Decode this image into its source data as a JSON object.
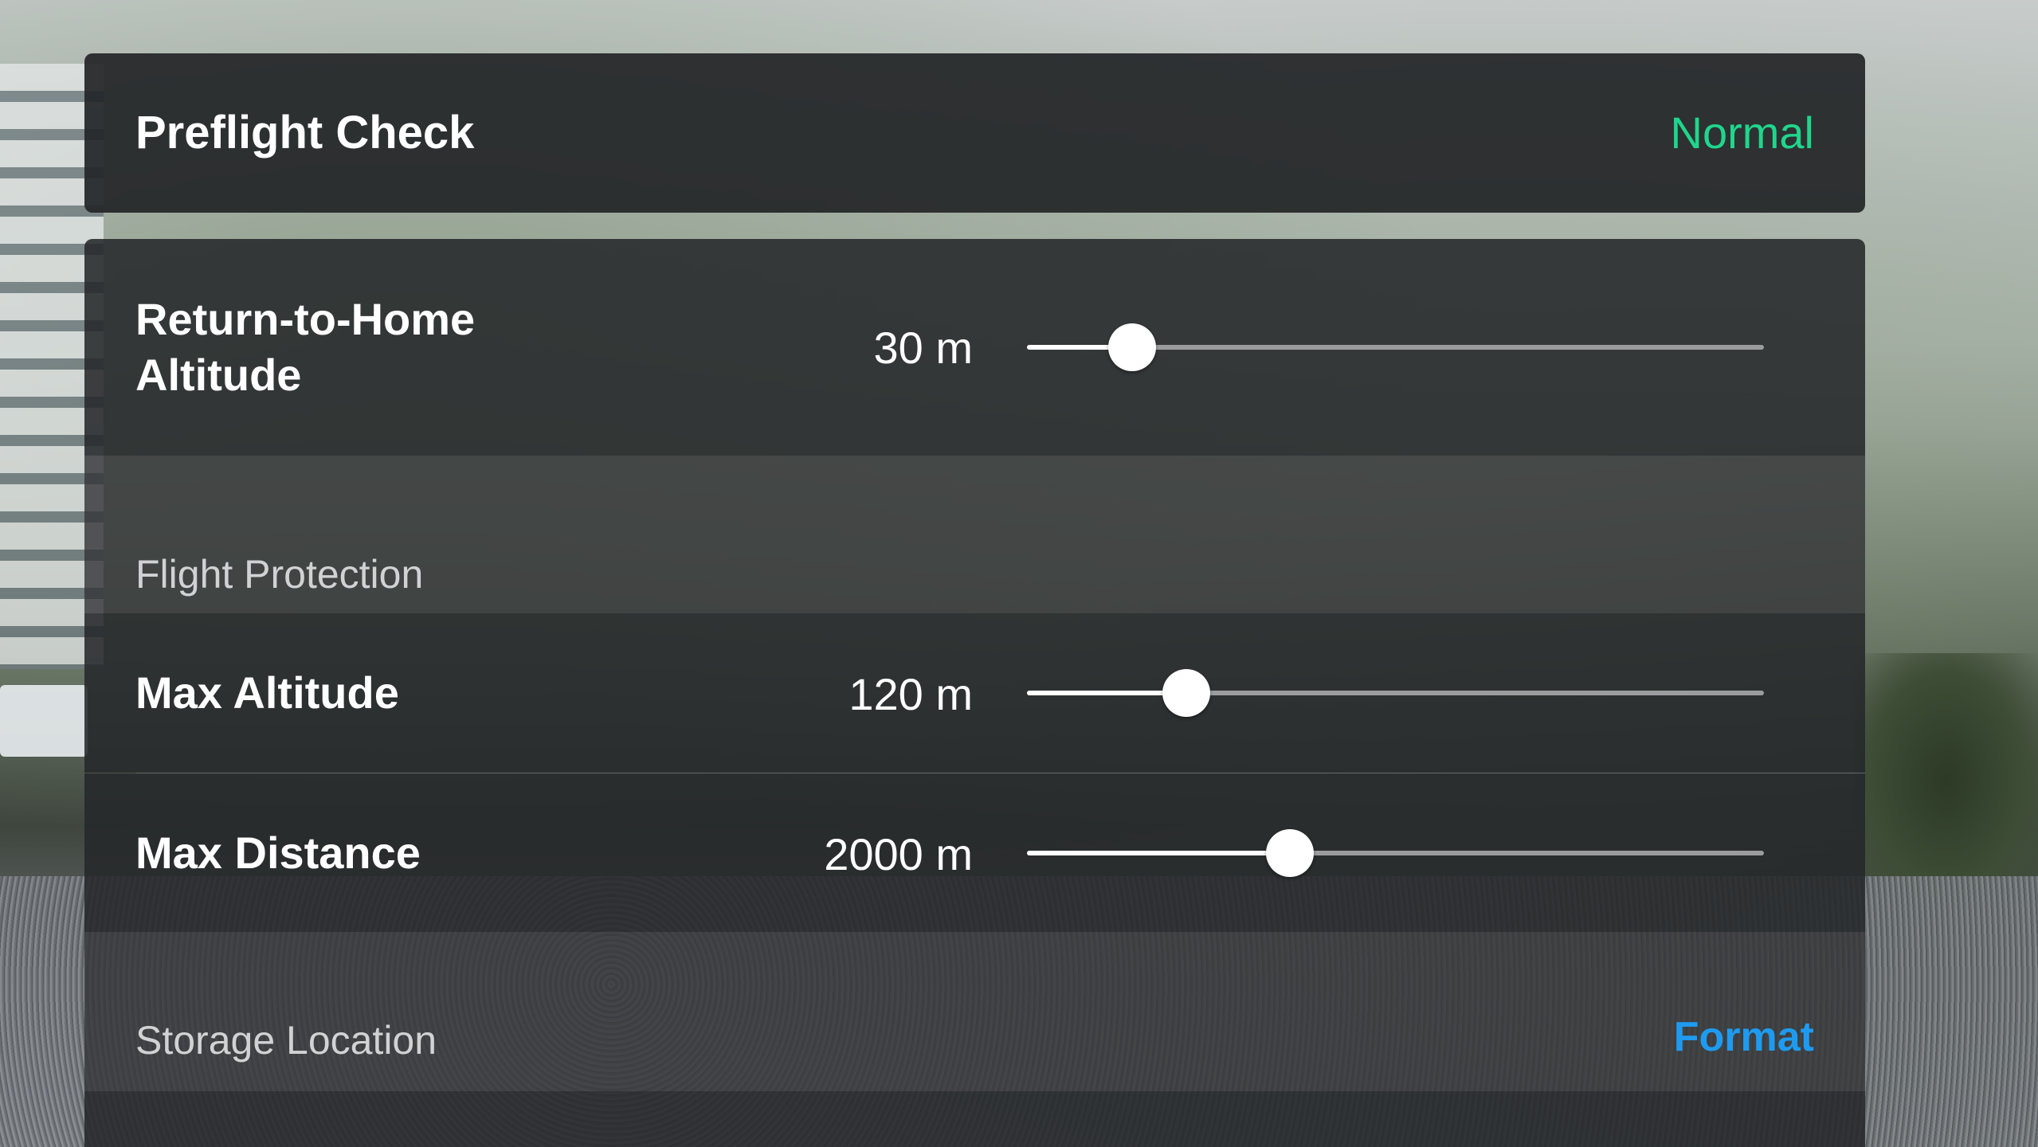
{
  "header": {
    "title": "Preflight Check",
    "status": "Normal",
    "status_color": "#1fd68c"
  },
  "settings": {
    "rth_altitude": {
      "label": "Return-to-Home Altitude",
      "value": "30 m",
      "slider_fraction": 0.143
    },
    "flight_protection": {
      "section_label": "Flight Protection"
    },
    "max_altitude": {
      "label": "Max Altitude",
      "value": "120 m",
      "slider_fraction": 0.216
    },
    "max_distance": {
      "label": "Max Distance",
      "value": "2000 m",
      "slider_fraction": 0.357
    },
    "storage": {
      "section_label": "Storage Location",
      "format_label": "Format",
      "format_color": "#1e9bf0"
    }
  }
}
